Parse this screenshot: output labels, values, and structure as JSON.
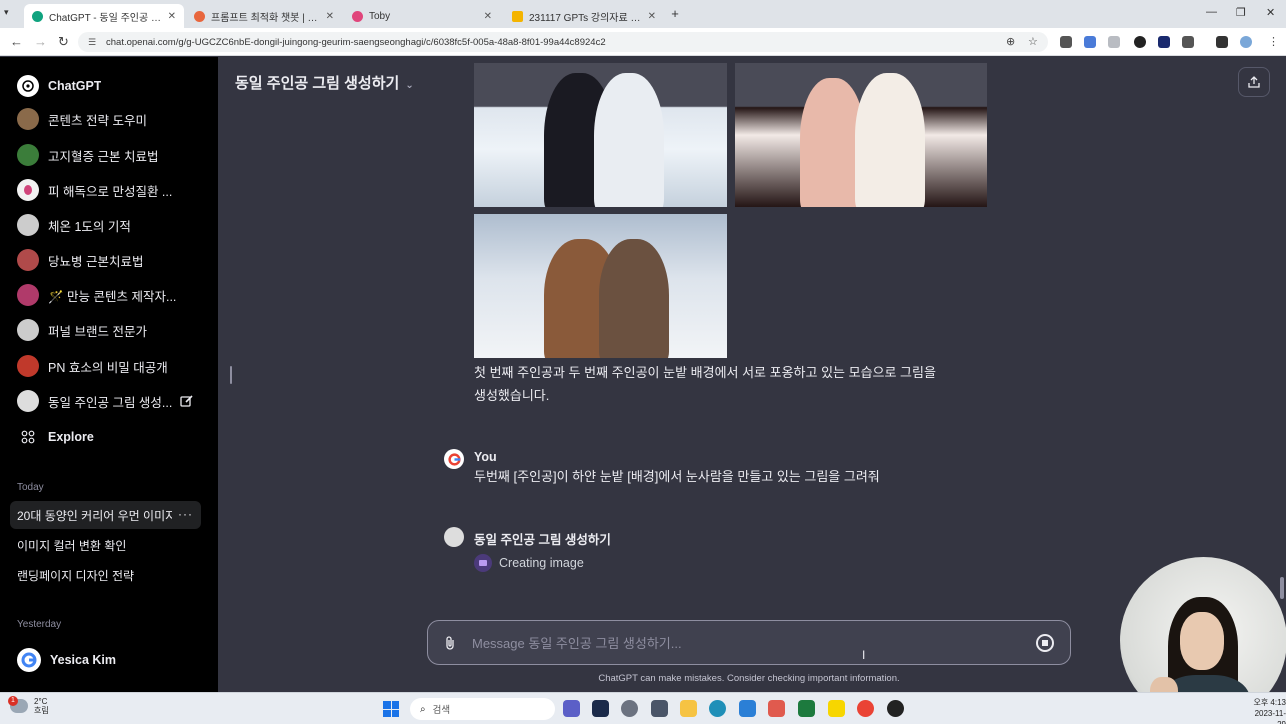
{
  "browser": {
    "tabs": [
      {
        "label": "ChatGPT - 동일 주인공 그림 생",
        "color": "#10a37f",
        "active": true
      },
      {
        "label": "프롬프트 최적화 챗봇 | GPTers",
        "color": "#e8663d",
        "active": false
      },
      {
        "label": "Toby",
        "color": "#e0457b",
        "active": false
      },
      {
        "label": "231117 GPTs 강의자료 - Goog",
        "color": "#f4b400",
        "active": false
      }
    ],
    "url": "chat.openai.com/g/g-UGCZC6nbE-dongil-juingong-geurim-saengseonghagi/c/6038fc5f-005a-48a8-8f01-99a44c8924c2"
  },
  "sidebar": {
    "brand": "ChatGPT",
    "gpts": [
      {
        "label": "콘텐츠 전략 도우미",
        "color": "#8a6a4a"
      },
      {
        "label": "고지혈증 근본 치료법",
        "color": "#3b7d3a"
      },
      {
        "label": "피 해독으로 만성질환 ...",
        "color": "#e4a0c0"
      },
      {
        "label": "체온 1도의 기적",
        "color": "#cccccc"
      },
      {
        "label": "당뇨병 근본치료법",
        "color": "#b04a4a"
      },
      {
        "label": "🪄 만능 콘텐츠 제작자...",
        "color": "#b03a6a"
      },
      {
        "label": "퍼널 브랜드 전문가",
        "color": "#cccccc"
      },
      {
        "label": "PN 효소의 비밀 대공개",
        "color": "#c0392b"
      },
      {
        "label": "동일 주인공 그림 생성...",
        "color": "#dddddd"
      }
    ],
    "explore": "Explore",
    "today_label": "Today",
    "today": [
      {
        "label": "20대 동양인 커리어 우먼 이미지",
        "active": true
      },
      {
        "label": "이미지 컬러 변환 확인",
        "active": false
      },
      {
        "label": "랜딩페이지 디자인 전략",
        "active": false
      }
    ],
    "yesterday_label": "Yesterday",
    "user": "Yesica Kim"
  },
  "main": {
    "title": "동일 주인공 그림 생성하기",
    "assistant_text_line1": "첫 번째 주인공과 두 번째 주인공이 눈밭 배경에서 서로 포옹하고 있는 모습으로 그림을",
    "assistant_text_line2": "생성했습니다.",
    "user_name": "You",
    "user_message": "두번째 [주인공]이 하얀 눈밭 [배경]에서 눈사람을 만들고 있는 그림을 그려줘",
    "gpt_name": "동일 주인공 그림 생성하기",
    "status": "Creating image",
    "composer_placeholder": "Message 동일 주인공 그림 생성하기...",
    "disclaimer": "ChatGPT can make mistakes. Consider checking important information."
  },
  "taskbar": {
    "weather_temp": "2°C",
    "weather_desc": "흐림",
    "weather_badge": "1",
    "search": "검색",
    "clock_time": "오후 4:13",
    "clock_date": "2023-11-29"
  }
}
